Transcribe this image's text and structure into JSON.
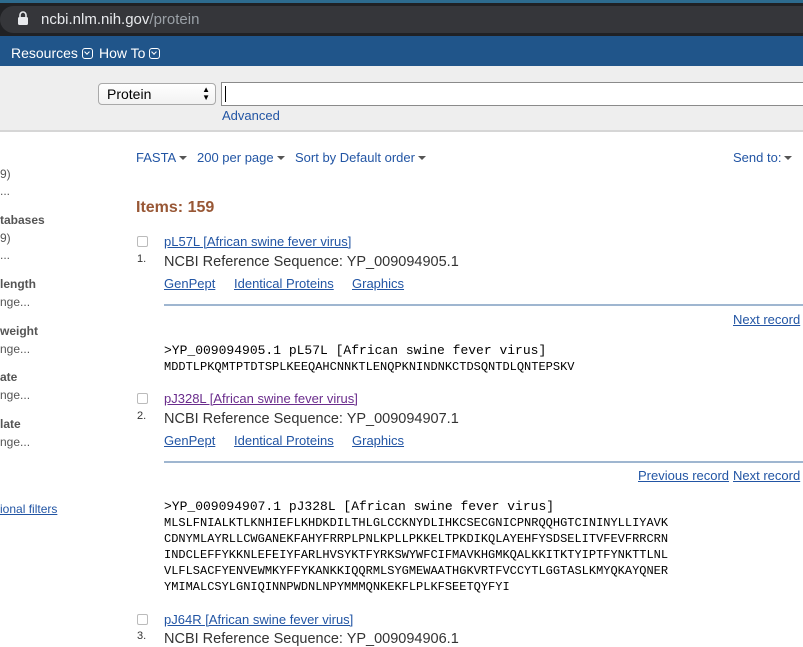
{
  "browser": {
    "url_host": "ncbi.nlm.nih.gov",
    "url_path": "/protein"
  },
  "nav": {
    "resources": "Resources",
    "howto": "How To"
  },
  "search": {
    "database": "Protein",
    "query": "",
    "advanced": "Advanced"
  },
  "sidebar": {
    "r1": "9)",
    "r2": "...",
    "h1": "tabases",
    "r3": "9)",
    "r4": "...",
    "h2": "length",
    "r5": "nge...",
    "h3": "weight",
    "r6": "nge...",
    "h4": "ate",
    "r7": "nge...",
    "h5": "late",
    "r8": "nge...",
    "filters": "ional filters"
  },
  "toolbar": {
    "format": "FASTA",
    "per_page": "200 per page",
    "sort": "Sort by Default order",
    "send_to": "Send to:"
  },
  "items_count": "Items: 159",
  "results": [
    {
      "num": "1.",
      "title": "pL57L [African swine fever virus]",
      "ref": "NCBI Reference Sequence: YP_009094905.1",
      "links": [
        "GenPept",
        "Identical Proteins",
        "Graphics"
      ],
      "next": "Next record",
      "fasta_header": ">YP_009094905.1 pL57L [African swine fever virus]",
      "fasta_seq": "MDDTLPKQMTPTDTSPLKEEQAHCNNKTLENQPKNINDNKCTDSQNTDLQNTEPSKV"
    },
    {
      "num": "2.",
      "title": "pJ328L [African swine fever virus]",
      "ref": "NCBI Reference Sequence: YP_009094907.1",
      "links": [
        "GenPept",
        "Identical Proteins",
        "Graphics"
      ],
      "prev": "Previous record",
      "next": "Next record",
      "fasta_header": ">YP_009094907.1 pJ328L [African swine fever virus]",
      "fasta_seq": "MLSLFNIALKTLKNHIEFLKHDKDILTHLGLCCKNYDLIHKCSECGNICPNRQQHGTCININYLLIYAVK\nCDNYMLAYRLLCWGANEKFAHYFRRPLPNLKPLLPKKELTPKDIKQLAYEHFYSDSELITVFEVFRRCRN\nINDCLEFFYKKNLEFEIYFARLHVSYKTFYRKSWYWFCIFMAVKHGMKQALKKITKTYIPTFYNKTTLNL\nVLFLSACFYENVEWMKYFFYKANKKIQQRMLSYGMEWAATHGKVRTFVCCYTLGGTASLKMYQKAYQNER\nYMIMALCSYLGNIQINNPWDNLNPYMMMQNKEKFLPLKFSEETQYFYI"
    },
    {
      "num": "3.",
      "title": "pJ64R [African swine fever virus]",
      "ref": "NCBI Reference Sequence: YP_009094906.1"
    }
  ]
}
